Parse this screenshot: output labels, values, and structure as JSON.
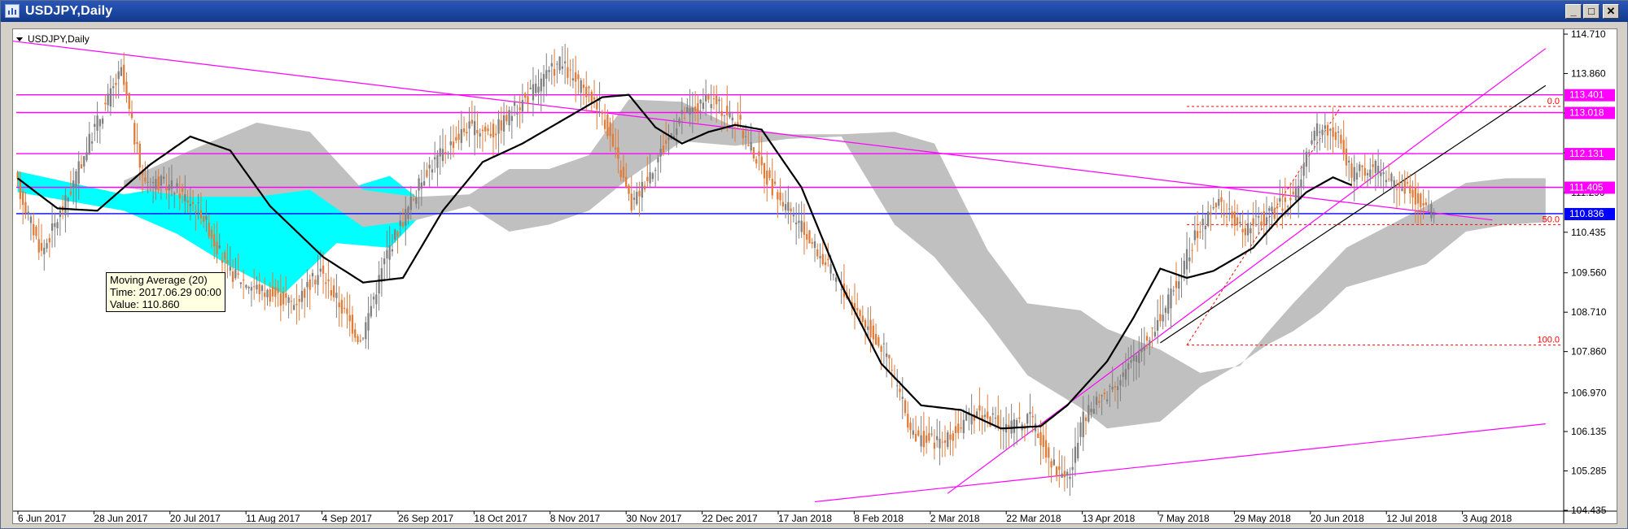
{
  "window": {
    "title": "USDJPY,Daily",
    "buttons": [
      "minimize",
      "maximize",
      "close"
    ]
  },
  "tooltip": {
    "line1": "Moving Average (20)",
    "line2": "Time: 2017.06.29 00:00",
    "line3": "Value: 110.860"
  },
  "colors": {
    "bull": "#808080",
    "bear": "#e07b39",
    "ma": "#000000",
    "cloud_a": "#00ffff",
    "cloud_b": "#c0c0c0",
    "lines": "#ff00ff",
    "fib": "#ff0000",
    "price_line": "#0000ff"
  },
  "chart_data": {
    "type": "candlestick",
    "title": "USDJPY,Daily",
    "symbol_label": "USDJPY,Daily",
    "x_labels": [
      "6 Jun 2017",
      "28 Jun 2017",
      "20 Jul 2017",
      "11 Aug 2017",
      "4 Sep 2017",
      "26 Sep 2017",
      "18 Oct 2017",
      "8 Nov 2017",
      "30 Nov 2017",
      "22 Dec 2017",
      "17 Jan 2018",
      "8 Feb 2018",
      "2 Mar 2018",
      "22 Mar 2018",
      "13 Apr 2018",
      "7 May 2018",
      "29 May 2018",
      "20 Jun 2018",
      "12 Jul 2018",
      "3 Aug 2018"
    ],
    "y_ticks": [
      "114.710",
      "113.860",
      "113.005",
      "112.150",
      "111.290",
      "110.435",
      "109.560",
      "108.710",
      "107.860",
      "106.970",
      "106.135",
      "105.285",
      "104.435"
    ],
    "ylim": [
      104.435,
      114.71
    ],
    "price_levels": [
      {
        "label": "113.401",
        "value": 113.401,
        "kind": "horizontal-line"
      },
      {
        "label": "113.018",
        "value": 113.018,
        "kind": "horizontal-line"
      },
      {
        "label": "112.131",
        "value": 112.131,
        "kind": "horizontal-line"
      },
      {
        "label": "111.405",
        "value": 111.405,
        "kind": "horizontal-line"
      },
      {
        "label": "110.836",
        "value": 110.836,
        "kind": "current-price"
      }
    ],
    "fibonacci": [
      {
        "label": "0.0",
        "value": 113.15
      },
      {
        "label": "50.0",
        "value": 110.6
      },
      {
        "label": "100.0",
        "value": 108.0
      }
    ],
    "moving_average": {
      "period": 20,
      "points": [
        [
          0,
          111.6
        ],
        [
          15,
          110.95
        ],
        [
          30,
          110.9
        ],
        [
          50,
          111.9
        ],
        [
          65,
          112.5
        ],
        [
          80,
          112.2
        ],
        [
          95,
          111.0
        ],
        [
          115,
          109.9
        ],
        [
          130,
          109.35
        ],
        [
          145,
          109.45
        ],
        [
          160,
          110.9
        ],
        [
          175,
          111.95
        ],
        [
          190,
          112.35
        ],
        [
          205,
          112.85
        ],
        [
          220,
          113.35
        ],
        [
          230,
          113.4
        ],
        [
          240,
          112.7
        ],
        [
          250,
          112.35
        ],
        [
          260,
          112.6
        ],
        [
          270,
          112.75
        ],
        [
          280,
          112.65
        ],
        [
          295,
          111.4
        ],
        [
          310,
          109.3
        ],
        [
          325,
          107.6
        ],
        [
          340,
          106.7
        ],
        [
          355,
          106.6
        ],
        [
          370,
          106.2
        ],
        [
          385,
          106.25
        ],
        [
          395,
          106.7
        ],
        [
          410,
          107.65
        ],
        [
          420,
          108.6
        ],
        [
          430,
          109.65
        ],
        [
          440,
          109.45
        ],
        [
          450,
          109.6
        ],
        [
          465,
          110.1
        ],
        [
          475,
          110.75
        ],
        [
          485,
          111.3
        ],
        [
          495,
          111.62
        ],
        [
          502,
          111.45
        ]
      ]
    },
    "cloud_segments": [
      {
        "color": "cloud_a",
        "upper": [
          [
            0,
            111.75
          ],
          [
            40,
            111.25
          ],
          [
            60,
            111.45
          ],
          [
            80,
            111.75
          ],
          [
            100,
            111.75
          ],
          [
            120,
            111.3
          ],
          [
            140,
            111.65
          ],
          [
            150,
            111.2
          ]
        ],
        "lower": [
          [
            150,
            110.7
          ],
          [
            140,
            110.1
          ],
          [
            120,
            110.2
          ],
          [
            100,
            109.1
          ],
          [
            80,
            109.7
          ],
          [
            60,
            110.4
          ],
          [
            40,
            110.9
          ],
          [
            0,
            111.3
          ]
        ]
      },
      {
        "color": "cloud_b",
        "upper": [
          [
            40,
            111.55
          ],
          [
            65,
            112.2
          ],
          [
            90,
            112.8
          ],
          [
            110,
            112.6
          ],
          [
            130,
            111.35
          ],
          [
            150,
            111.2
          ],
          [
            170,
            111.25
          ],
          [
            185,
            111.8
          ],
          [
            200,
            111.8
          ],
          [
            215,
            112.1
          ],
          [
            230,
            113.3
          ],
          [
            250,
            113.25
          ],
          [
            270,
            112.7
          ],
          [
            290,
            112.55
          ],
          [
            310,
            112.55
          ],
          [
            330,
            112.6
          ],
          [
            345,
            112.35
          ],
          [
            365,
            110.05
          ],
          [
            380,
            108.9
          ],
          [
            400,
            108.75
          ],
          [
            410,
            108.35
          ],
          [
            430,
            107.9
          ],
          [
            445,
            107.4
          ],
          [
            460,
            107.55
          ],
          [
            470,
            108.25
          ],
          [
            480,
            108.9
          ],
          [
            490,
            109.5
          ],
          [
            500,
            110.1
          ],
          [
            515,
            110.55
          ],
          [
            530,
            111.0
          ],
          [
            545,
            111.5
          ],
          [
            560,
            111.6
          ],
          [
            575,
            111.6
          ]
        ],
        "lower": [
          [
            575,
            110.65
          ],
          [
            560,
            110.6
          ],
          [
            545,
            110.45
          ],
          [
            530,
            109.75
          ],
          [
            515,
            109.5
          ],
          [
            500,
            109.25
          ],
          [
            490,
            108.7
          ],
          [
            480,
            108.3
          ],
          [
            470,
            108.0
          ],
          [
            460,
            107.6
          ],
          [
            445,
            107.1
          ],
          [
            430,
            106.35
          ],
          [
            410,
            106.2
          ],
          [
            400,
            106.65
          ],
          [
            380,
            107.35
          ],
          [
            365,
            108.5
          ],
          [
            345,
            109.9
          ],
          [
            330,
            110.6
          ],
          [
            310,
            112.5
          ],
          [
            290,
            112.45
          ],
          [
            270,
            112.3
          ],
          [
            250,
            112.4
          ],
          [
            230,
            111.6
          ],
          [
            215,
            110.9
          ],
          [
            200,
            110.6
          ],
          [
            185,
            110.45
          ],
          [
            170,
            111.0
          ],
          [
            150,
            110.7
          ],
          [
            130,
            110.55
          ],
          [
            110,
            111.35
          ],
          [
            90,
            111.2
          ],
          [
            65,
            111.2
          ],
          [
            40,
            111.4
          ]
        ]
      }
    ],
    "trend_lines": [
      {
        "name": "long-downtrend",
        "from": [
          -80,
          115.1
        ],
        "to": [
          555,
          110.7
        ]
      },
      {
        "name": "long-uptrend",
        "from": [
          300,
          104.62
        ],
        "to": [
          575,
          106.3
        ]
      },
      {
        "name": "channel-upper",
        "from": [
          350,
          104.8
        ],
        "to": [
          575,
          114.4
        ]
      },
      {
        "name": "channel-lower",
        "from": [
          430,
          108.05
        ],
        "to": [
          575,
          113.6
        ]
      }
    ]
  }
}
